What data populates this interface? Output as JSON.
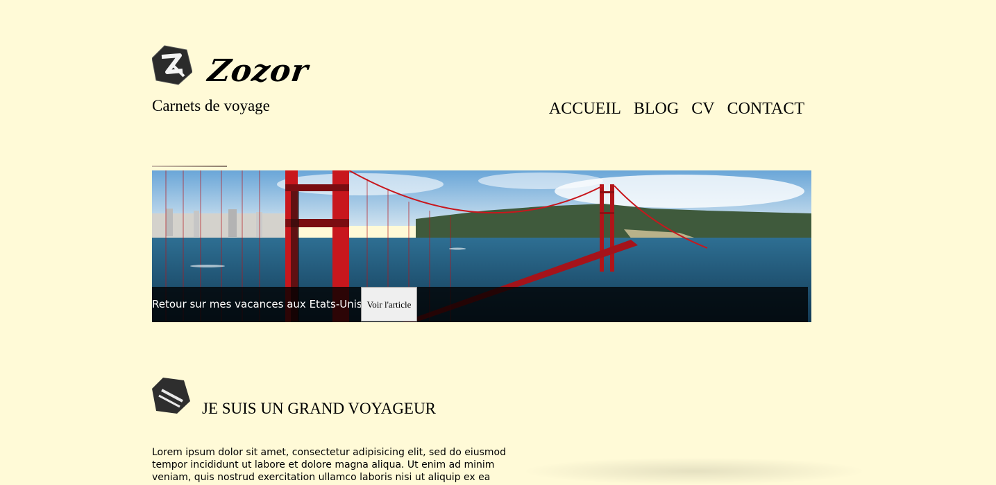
{
  "brand": {
    "logo_icon": "zozor-logo-icon",
    "title": "Zozor",
    "tagline": "Carnets de voyage"
  },
  "nav": {
    "items": [
      {
        "label": "ACCUEIL"
      },
      {
        "label": "BLOG"
      },
      {
        "label": "CV"
      },
      {
        "label": "CONTACT"
      }
    ]
  },
  "banner": {
    "caption": "Retour sur mes vacances aux Etats-Unis...",
    "button_label": "Voir l'article",
    "image": "golden-gate-bridge-photo"
  },
  "section": {
    "icon": "suitcase-icon",
    "title": "JE SUIS UN GRAND VOYAGEUR",
    "body": "Lorem ipsum dolor sit amet, consectetur adipisicing elit, sed do eiusmod tempor incididunt ut labore et dolore magna aliqua. Ut enim ad minim veniam, quis nostrud exercitation ullamco laboris nisi ut aliquip ex ea"
  },
  "colors": {
    "background": "#fffad7",
    "bridge": "#c8171d",
    "caption_bar": "#000000"
  }
}
